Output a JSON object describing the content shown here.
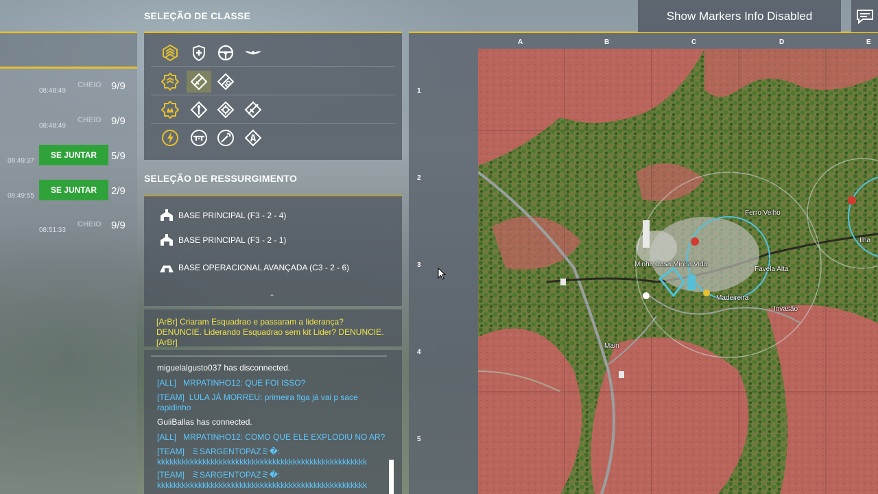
{
  "headers": {
    "class_selection": "SELEÇÃO DE CLASSE",
    "respawn_selection": "SELEÇÃO DE RESSURGIMENTO"
  },
  "markers_toggle_label": "Show Markers Info Disabled",
  "squads": [
    {
      "time": "08:48:49",
      "status": "CHEIO",
      "count": "9/9",
      "join": null
    },
    {
      "time": "08:48:49",
      "status": "CHEIO",
      "count": "9/9",
      "join": null
    },
    {
      "time": "08:49:37",
      "status": null,
      "count": "5/9",
      "join": "SE JUNTAR"
    },
    {
      "time": "08:49:55",
      "status": null,
      "count": "2/9",
      "join": "SE JUNTAR"
    },
    {
      "time": "08:51:33",
      "status": "CHEIO",
      "count": "9/9",
      "join": null
    }
  ],
  "class_icons": [
    [
      "squad-leader-icon",
      "medic-icon",
      "driver-icon",
      "pilot-icon"
    ],
    [
      "fireteam-leader-icon",
      "rifleman-icon",
      "grenadier-icon"
    ],
    [
      "commander-icon",
      "automatic-rifleman-icon",
      "marksman-icon",
      "sniper-icon"
    ],
    [
      "crewman-icon",
      "machine-gunner-icon",
      "engineer-icon",
      "lat-icon"
    ]
  ],
  "spawn_points": [
    {
      "label": "BASE PRINCIPAL (F3 - 2 - 4)"
    },
    {
      "label": "BASE PRINCIPAL (F3 - 2 - 1)"
    },
    {
      "label": "BASE OPERACIONAL AVANÇADA (C3 - 2 - 6)"
    }
  ],
  "announcement": "[ArBr] Criaram Esquadrao e passaram a liderança? DENUNCIE. Liderando Esquadrao sem kit Lider? DENUNCIE. [ArBr]",
  "chat": [
    {
      "channel": "",
      "text": "miguelalgusto037 has disconnected."
    },
    {
      "channel": "[ALL]",
      "text": "MRPATINHO12: QUE FOI ISSO?"
    },
    {
      "channel": "[TEAM]",
      "text": "LULA JÁ MORREU: primeira flga já vai p sace"
    },
    {
      "channel": "",
      "text": "rapidinho"
    },
    {
      "channel": "",
      "text": "GuiiBallas has connected."
    },
    {
      "channel": "[ALL]",
      "text": "MRPATINHO12: COMO QUE ELE EXPLODIU NO AR?"
    },
    {
      "channel": "[TEAM]",
      "text": "ミSARGENTOPAZミ�:"
    },
    {
      "channel": "",
      "text": "kkkkkkkkkkkkkkkkkkkkkkkkkkkkkkkkkkkkkkkkkkkkkkkkkkk"
    },
    {
      "channel": "[TEAM]",
      "text": "ミSARGENTOPAZミ�:"
    },
    {
      "channel": "",
      "text": "kkkkkkkkkkkkkkkkkkkkkkkkkkkkkkkkkkkkkkkkkkkkkkkkkkk"
    }
  ],
  "map": {
    "columns": [
      "A",
      "B",
      "C",
      "D",
      "E"
    ],
    "rows": [
      "1",
      "2",
      "3",
      "4",
      "5"
    ],
    "locations": [
      "Ferro Velho",
      "Minha Casa Minha Vida",
      "Favela Alta",
      "Madeireira",
      "Invasão",
      "Main",
      "Ilha"
    ]
  },
  "colors": {
    "accent": "#e6c12e",
    "join": "#2fa33a",
    "team_chat": "#5ec7ff",
    "announcement": "#f0e24a"
  }
}
